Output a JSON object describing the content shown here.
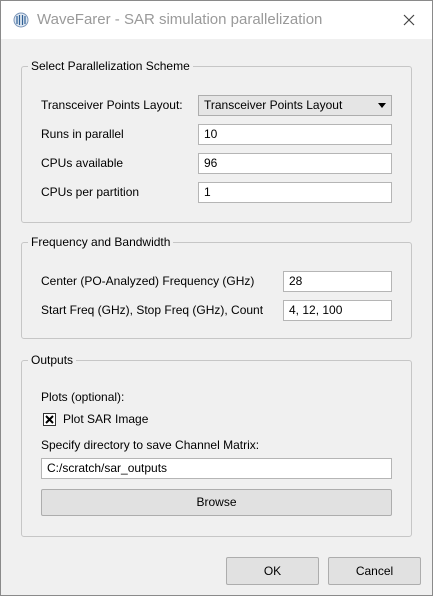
{
  "window": {
    "title": "WaveFarer - SAR simulation parallelization",
    "app_icon": "wavefarer-logo-icon",
    "close_icon": "close-icon"
  },
  "parallelization": {
    "legend": "Select Parallelization Scheme",
    "layout_label": "Transceiver Points Layout:",
    "layout_value": "Transceiver Points Layout",
    "runs_label": "Runs in parallel",
    "runs_value": "10",
    "cpus_label": "CPUs available",
    "cpus_value": "96",
    "cpp_label": "CPUs per partition",
    "cpp_value": "1"
  },
  "frequency": {
    "legend": "Frequency and Bandwidth",
    "center_label": "Center (PO-Analyzed) Frequency (GHz)",
    "center_value": "28",
    "range_label": "Start Freq (GHz), Stop Freq (GHz), Count",
    "range_value": "4, 12, 100"
  },
  "outputs": {
    "legend": "Outputs",
    "plots_label": "Plots (optional):",
    "plot_sar_label": "Plot SAR Image",
    "plot_sar_checked": true,
    "dir_label": "Specify directory to save Channel Matrix:",
    "dir_value": "C:/scratch/sar_outputs",
    "browse_label": "Browse"
  },
  "footer": {
    "ok_label": "OK",
    "cancel_label": "Cancel"
  }
}
